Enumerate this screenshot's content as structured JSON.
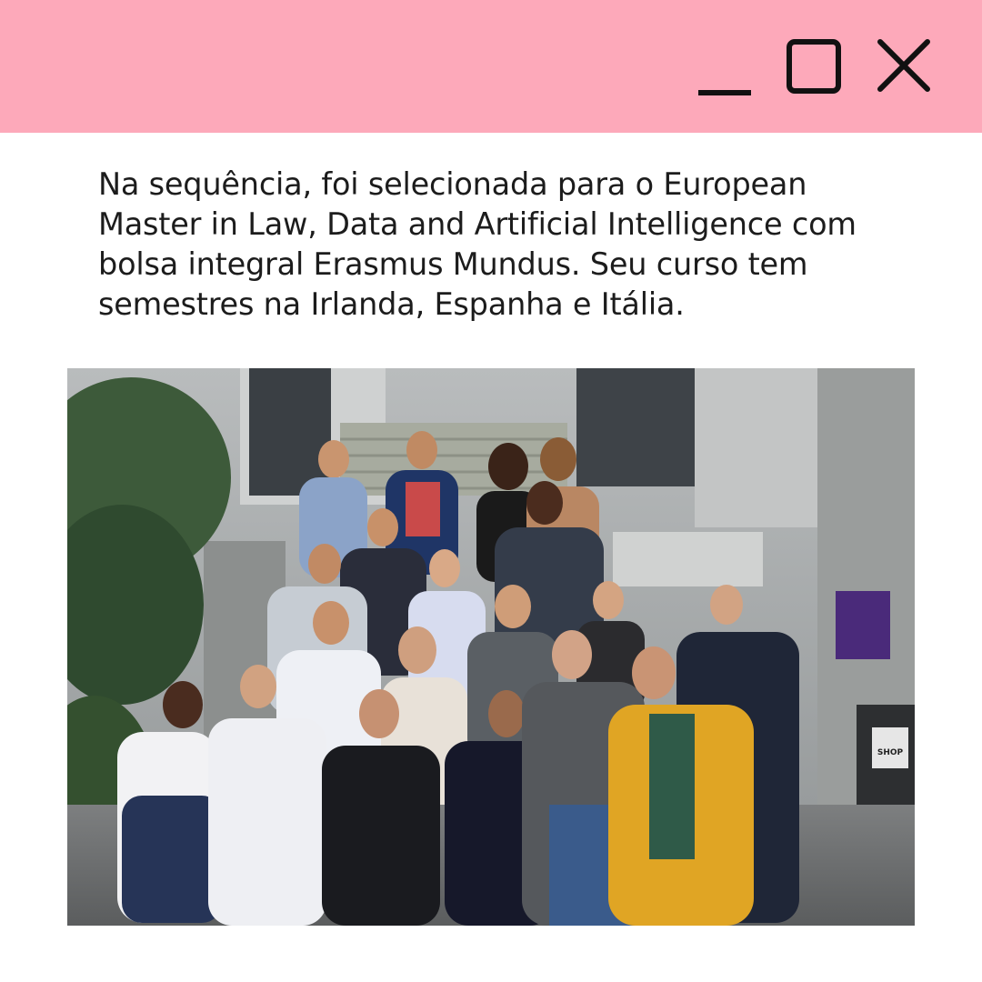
{
  "window": {
    "titlebar_color": "#fda9ba",
    "controls": {
      "minimize_icon": "minimize-icon",
      "maximize_icon": "maximize-icon",
      "close_icon": "close-icon"
    }
  },
  "content": {
    "paragraph": "Na sequência, foi selecionada para o European\nMaster in Law, Data and Artificial Intelligence com\nbolsa integral Erasmus Mundus. Seu curso tem\nsemestres na Irlanda, Espanha e Itália."
  },
  "photo": {
    "sign_text": "SHOP"
  }
}
